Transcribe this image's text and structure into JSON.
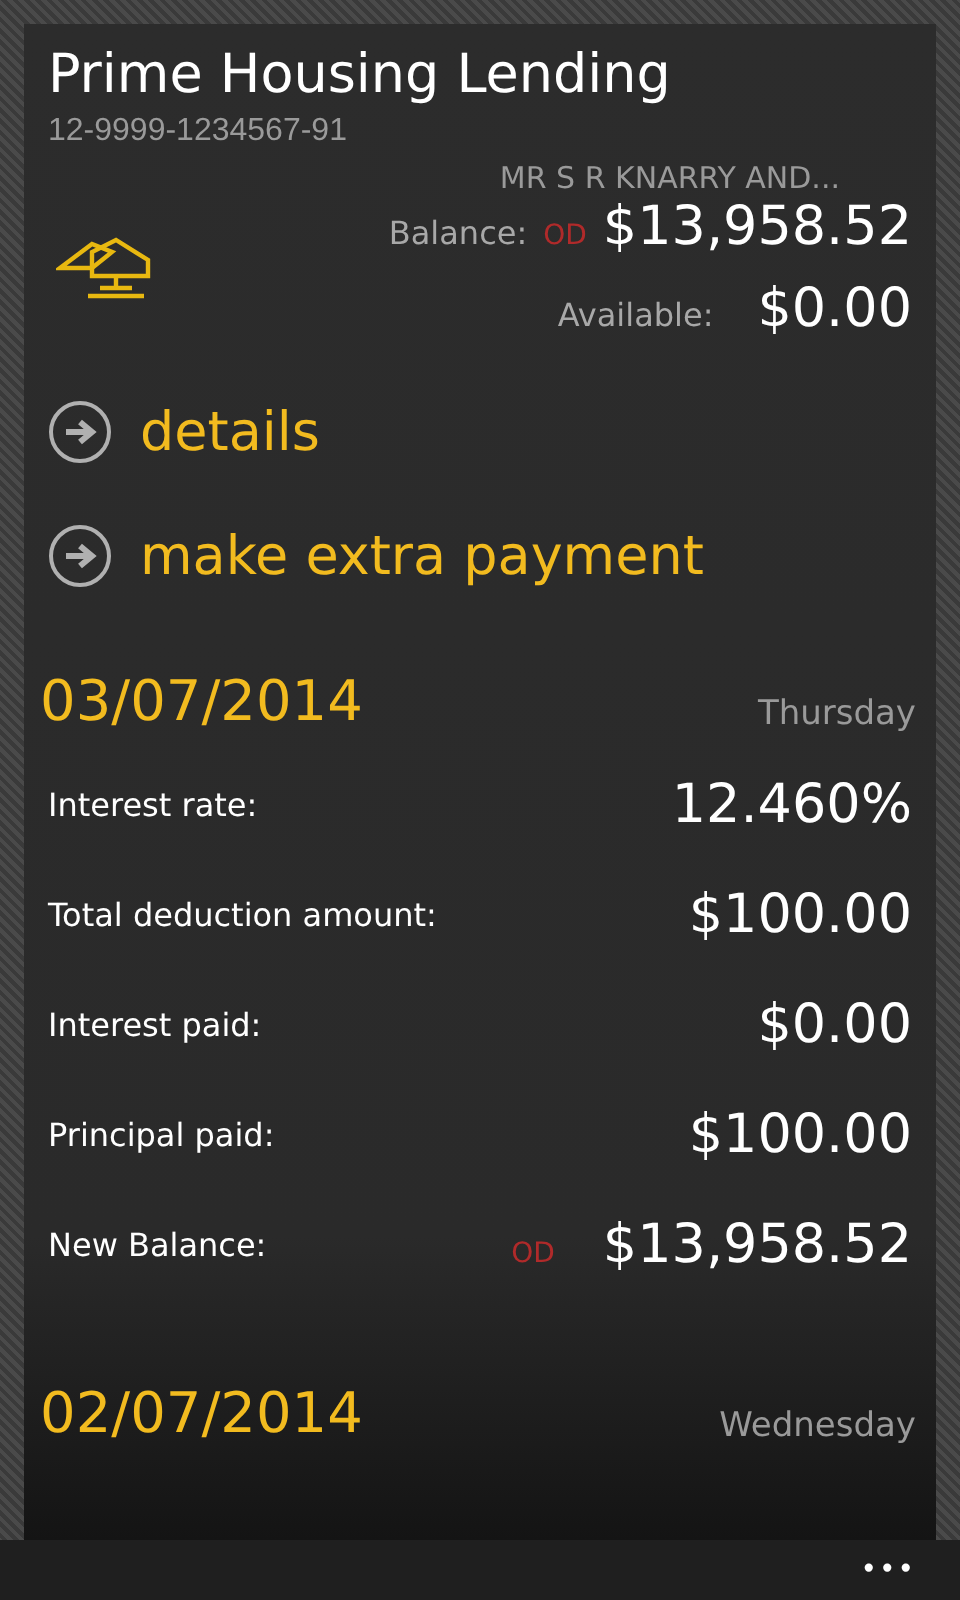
{
  "account": {
    "title": "Prime Housing Lending",
    "number": "12-9999-1234567-91",
    "holder": "MR S R KNARRY AND...",
    "balance": {
      "label": "Balance:",
      "indicator": "OD",
      "amount": "$13,958.52"
    },
    "available": {
      "label": "Available:",
      "amount": "$0.00"
    }
  },
  "links": [
    {
      "label": "details"
    },
    {
      "label": "make extra payment"
    }
  ],
  "transactions": [
    {
      "date": "03/07/2014",
      "weekday": "Thursday",
      "rows": [
        {
          "label": "Interest rate:",
          "value": "12.460%"
        },
        {
          "label": "Total deduction amount:",
          "value": "$100.00"
        },
        {
          "label": "Interest paid:",
          "value": "$0.00"
        },
        {
          "label": "Principal paid:",
          "value": "$100.00"
        },
        {
          "label": "New Balance:",
          "indicator": "OD",
          "value": "$13,958.52"
        }
      ]
    },
    {
      "date": "02/07/2014",
      "weekday": "Wednesday"
    }
  ],
  "app_bar": {
    "more": "•••"
  }
}
